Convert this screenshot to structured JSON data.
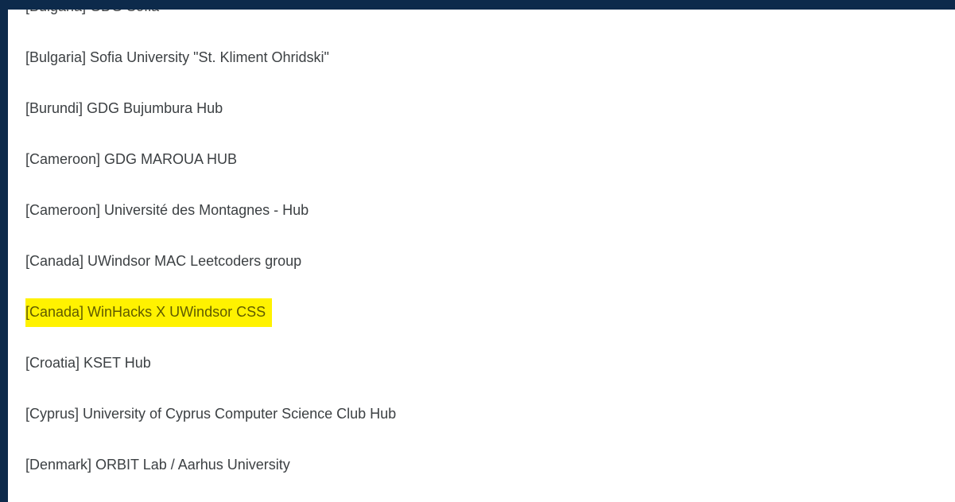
{
  "list": {
    "items": [
      {
        "label": "[Bulgaria] GDG Sofia"
      },
      {
        "label": "[Bulgaria] Sofia University \"St. Kliment Ohridski\""
      },
      {
        "label": "[Burundi] GDG Bujumbura Hub"
      },
      {
        "label": "[Cameroon] GDG MAROUA HUB"
      },
      {
        "label": "[Cameroon] Université des Montagnes - Hub"
      },
      {
        "label": "[Canada] UWindsor MAC Leetcoders group"
      },
      {
        "label": "[Canada] WinHacks X UWindsor CSS",
        "selected": true
      },
      {
        "label": "[Croatia] KSET Hub"
      },
      {
        "label": "[Cyprus] University of Cyprus Computer Science Club Hub"
      },
      {
        "label": "[Denmark] ORBIT Lab / Aarhus University"
      }
    ],
    "highlight_color": "#fff200",
    "text_color": "#3c4043",
    "frame_color": "#0d2a4b"
  }
}
